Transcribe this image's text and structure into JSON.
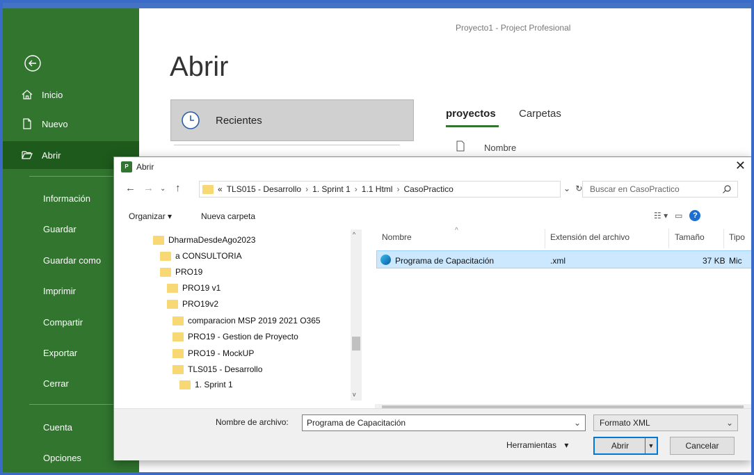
{
  "app": {
    "title": "Proyecto1  -  Project Profesional"
  },
  "sidebar": {
    "colors": {
      "bg": "#31752f",
      "active": "#1e5a1c"
    },
    "items": [
      {
        "label": "Inicio",
        "icon": "home-icon"
      },
      {
        "label": "Nuevo",
        "icon": "new-document-icon"
      },
      {
        "label": "Abrir",
        "icon": "open-folder-icon"
      },
      {
        "label": "Información"
      },
      {
        "label": "Guardar"
      },
      {
        "label": "Guardar como"
      },
      {
        "label": "Imprimir"
      },
      {
        "label": "Compartir"
      },
      {
        "label": "Exportar"
      },
      {
        "label": "Cerrar"
      },
      {
        "label": "Cuenta"
      },
      {
        "label": "Opciones"
      }
    ]
  },
  "backstage": {
    "page_title": "Abrir",
    "recent_label": "Recientes",
    "tabs": [
      "proyectos",
      "Carpetas"
    ],
    "name_column": "Nombre"
  },
  "dialog": {
    "title": "Abrir",
    "title_icon": "P",
    "breadcrumb": [
      "«",
      "TLS015 - Desarrollo",
      "1. Sprint 1",
      "1.1 Html",
      "CasoPractico"
    ],
    "search_placeholder": "Buscar en CasoPractico",
    "organize_label": "Organizar ▾",
    "new_folder_label": "Nueva carpeta",
    "tree": [
      {
        "label": "DharmaDesdeAgo2023"
      },
      {
        "label": "a CONSULTORIA"
      },
      {
        "label": "PRO19"
      },
      {
        "label": "PRO19 v1"
      },
      {
        "label": "PRO19v2"
      },
      {
        "label": "comparacion MSP 2019 2021 O365"
      },
      {
        "label": "PRO19 - Gestion de Proyecto"
      },
      {
        "label": "PRO19 - MockUP"
      },
      {
        "label": "TLS015 - Desarrollo"
      },
      {
        "label": "1. Sprint 1"
      }
    ],
    "columns": [
      "Nombre",
      "Extensión del archivo",
      "Tamaño",
      "Tipo"
    ],
    "files": [
      {
        "name": "Programa de Capacitación",
        "ext": ".xml",
        "size": "37 KB",
        "type": "Mic"
      }
    ],
    "filename_label": "Nombre de archivo:",
    "filename_value": "Programa de Capacitación",
    "filetype": "Formato XML",
    "tools_label": "Herramientas",
    "open_label": "Abrir",
    "cancel_label": "Cancelar"
  }
}
